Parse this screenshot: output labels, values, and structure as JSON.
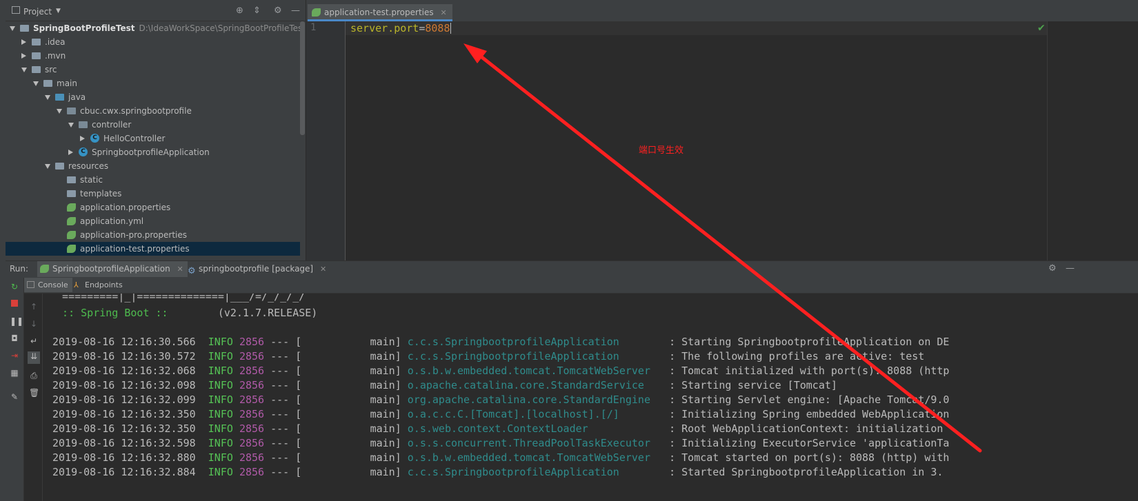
{
  "project": {
    "title": "Project",
    "tree": [
      {
        "label": "SpringBootProfileTest",
        "path": "D:\\IdeaWorkSpace\\SpringBootProfileTest",
        "indent": 0,
        "arrow": "down",
        "icon": "module",
        "bold": true
      },
      {
        "label": ".idea",
        "indent": 1,
        "arrow": "right",
        "icon": "folder"
      },
      {
        "label": ".mvn",
        "indent": 1,
        "arrow": "right",
        "icon": "folder"
      },
      {
        "label": "src",
        "indent": 1,
        "arrow": "down",
        "icon": "folder"
      },
      {
        "label": "main",
        "indent": 2,
        "arrow": "down",
        "icon": "folder"
      },
      {
        "label": "java",
        "indent": 3,
        "arrow": "down",
        "icon": "folder-blue"
      },
      {
        "label": "cbuc.cwx.springbootprofile",
        "indent": 4,
        "arrow": "down",
        "icon": "package"
      },
      {
        "label": "controller",
        "indent": 5,
        "arrow": "down",
        "icon": "package"
      },
      {
        "label": "HelloController",
        "indent": 6,
        "arrow": "right",
        "icon": "class"
      },
      {
        "label": "SpringbootprofileApplication",
        "indent": 5,
        "arrow": "right",
        "icon": "spring-class"
      },
      {
        "label": "resources",
        "indent": 3,
        "arrow": "down",
        "icon": "folder"
      },
      {
        "label": "static",
        "indent": 4,
        "arrow": "none",
        "icon": "folder"
      },
      {
        "label": "templates",
        "indent": 4,
        "arrow": "none",
        "icon": "folder"
      },
      {
        "label": "application.properties",
        "indent": 4,
        "arrow": "none",
        "icon": "spring-leaf"
      },
      {
        "label": "application.yml",
        "indent": 4,
        "arrow": "none",
        "icon": "spring-leaf"
      },
      {
        "label": "application-pro.properties",
        "indent": 4,
        "arrow": "none",
        "icon": "spring-leaf"
      },
      {
        "label": "application-test.properties",
        "indent": 4,
        "arrow": "none",
        "icon": "spring-leaf",
        "selected": true
      }
    ]
  },
  "editor": {
    "tab_label": "application-test.properties",
    "line_number": "1",
    "code_key": "server.port",
    "code_eq": "=",
    "code_value": "8088",
    "annotation": "端口号生效"
  },
  "run": {
    "label": "Run:",
    "tabs": [
      "SpringbootprofileApplication",
      "springbootprofile [package]"
    ],
    "subtabs": [
      "Console",
      "Endpoints"
    ]
  },
  "console": {
    "banner1": "  =========|_|==============|___/=/_/_/_/",
    "banner2_prefix": "  :: Spring Boot ::",
    "banner2_version": "        (v2.1.7.RELEASE)",
    "log": [
      {
        "ts": "2019-08-16 12:16:30.566",
        "level": "INFO",
        "pid": "2856",
        "sep": "---",
        "thread": "[           main]",
        "logger": "c.c.s.SpringbootprofileApplication      ",
        "msg": ": Starting SpringbootprofileApplication on DE"
      },
      {
        "ts": "2019-08-16 12:16:30.572",
        "level": "INFO",
        "pid": "2856",
        "sep": "---",
        "thread": "[           main]",
        "logger": "c.c.s.SpringbootprofileApplication      ",
        "msg": ": The following profiles are active: test"
      },
      {
        "ts": "2019-08-16 12:16:32.068",
        "level": "INFO",
        "pid": "2856",
        "sep": "---",
        "thread": "[           main]",
        "logger": "o.s.b.w.embedded.tomcat.TomcatWebServer ",
        "msg": ": Tomcat initialized with port(s): 8088 (http"
      },
      {
        "ts": "2019-08-16 12:16:32.098",
        "level": "INFO",
        "pid": "2856",
        "sep": "---",
        "thread": "[           main]",
        "logger": "o.apache.catalina.core.StandardService  ",
        "msg": ": Starting service [Tomcat]"
      },
      {
        "ts": "2019-08-16 12:16:32.099",
        "level": "INFO",
        "pid": "2856",
        "sep": "---",
        "thread": "[           main]",
        "logger": "org.apache.catalina.core.StandardEngine ",
        "msg": ": Starting Servlet engine: [Apache Tomcat/9.0"
      },
      {
        "ts": "2019-08-16 12:16:32.350",
        "level": "INFO",
        "pid": "2856",
        "sep": "---",
        "thread": "[           main]",
        "logger": "o.a.c.c.C.[Tomcat].[localhost].[/]      ",
        "msg": ": Initializing Spring embedded WebApplication"
      },
      {
        "ts": "2019-08-16 12:16:32.350",
        "level": "INFO",
        "pid": "2856",
        "sep": "---",
        "thread": "[           main]",
        "logger": "o.s.web.context.ContextLoader           ",
        "msg": ": Root WebApplicationContext: initialization"
      },
      {
        "ts": "2019-08-16 12:16:32.598",
        "level": "INFO",
        "pid": "2856",
        "sep": "---",
        "thread": "[           main]",
        "logger": "o.s.s.concurrent.ThreadPoolTaskExecutor ",
        "msg": ": Initializing ExecutorService 'applicationTa"
      },
      {
        "ts": "2019-08-16 12:16:32.880",
        "level": "INFO",
        "pid": "2856",
        "sep": "---",
        "thread": "[           main]",
        "logger": "o.s.b.w.embedded.tomcat.TomcatWebServer ",
        "msg": ": Tomcat started on port(s): 8088 (http) with"
      },
      {
        "ts": "2019-08-16 12:16:32.884",
        "level": "INFO",
        "pid": "2856",
        "sep": "---",
        "thread": "[           main]",
        "logger": "c.c.s.SpringbootprofileApplication      ",
        "msg": ": Started SpringbootprofileApplication in 3."
      }
    ]
  },
  "colors": {
    "annotation_red": "#ff2020",
    "selection": "#0d293e",
    "info_green": "#55c255",
    "pid_purple": "#b05aa8",
    "logger_teal": "#2f8c8c"
  }
}
